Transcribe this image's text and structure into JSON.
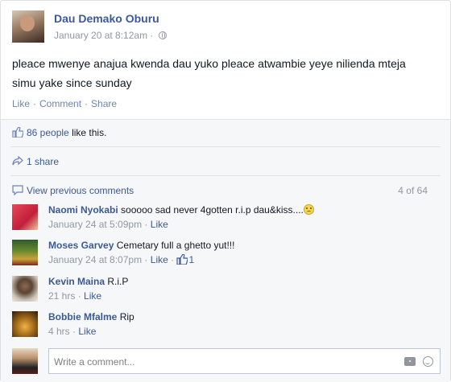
{
  "post": {
    "author": "Dau Demako Oburu",
    "timestamp": "January 20 at 8:12am",
    "meta_separator": "·",
    "privacy_icon": "globe-icon",
    "text": "pleace mwenye anajua kwenda dau yuko pleace atwambie yeye nilienda mteja simu yake since sunday",
    "actions": {
      "like": "Like",
      "comment": "Comment",
      "share": "Share",
      "separator": "·"
    }
  },
  "ufi": {
    "likes_count": "86 people",
    "likes_suffix": "like this.",
    "shares": "1 share",
    "view_previous": "View previous comments",
    "comment_count": "4 of 64",
    "comments": [
      {
        "name": "Naomi Nyokabi",
        "text": "sooooo sad never 4gotten r.i.p dau&kiss....",
        "time": "January 24 at 5:09pm",
        "like": "Like",
        "sep": "·",
        "emoji": "smiley-icon"
      },
      {
        "name": "Moses Garvey",
        "text": "Cemetary full a ghetto yut!!!",
        "time": "January 24 at 8:07pm",
        "like": "Like",
        "sep": "·",
        "like_count": "1"
      },
      {
        "name": "Kevin Maina",
        "text": "R.i.P",
        "time": "21 hrs",
        "like": "Like",
        "sep": "·"
      },
      {
        "name": "Bobbie Mfalme",
        "text": "Rip",
        "time": "4 hrs",
        "like": "Like",
        "sep": "·"
      }
    ],
    "write_placeholder": "Write a comment...",
    "colors": {
      "link": "#3b5998",
      "meta": "#9197a3",
      "ufi_bg": "#f6f7f9"
    }
  }
}
